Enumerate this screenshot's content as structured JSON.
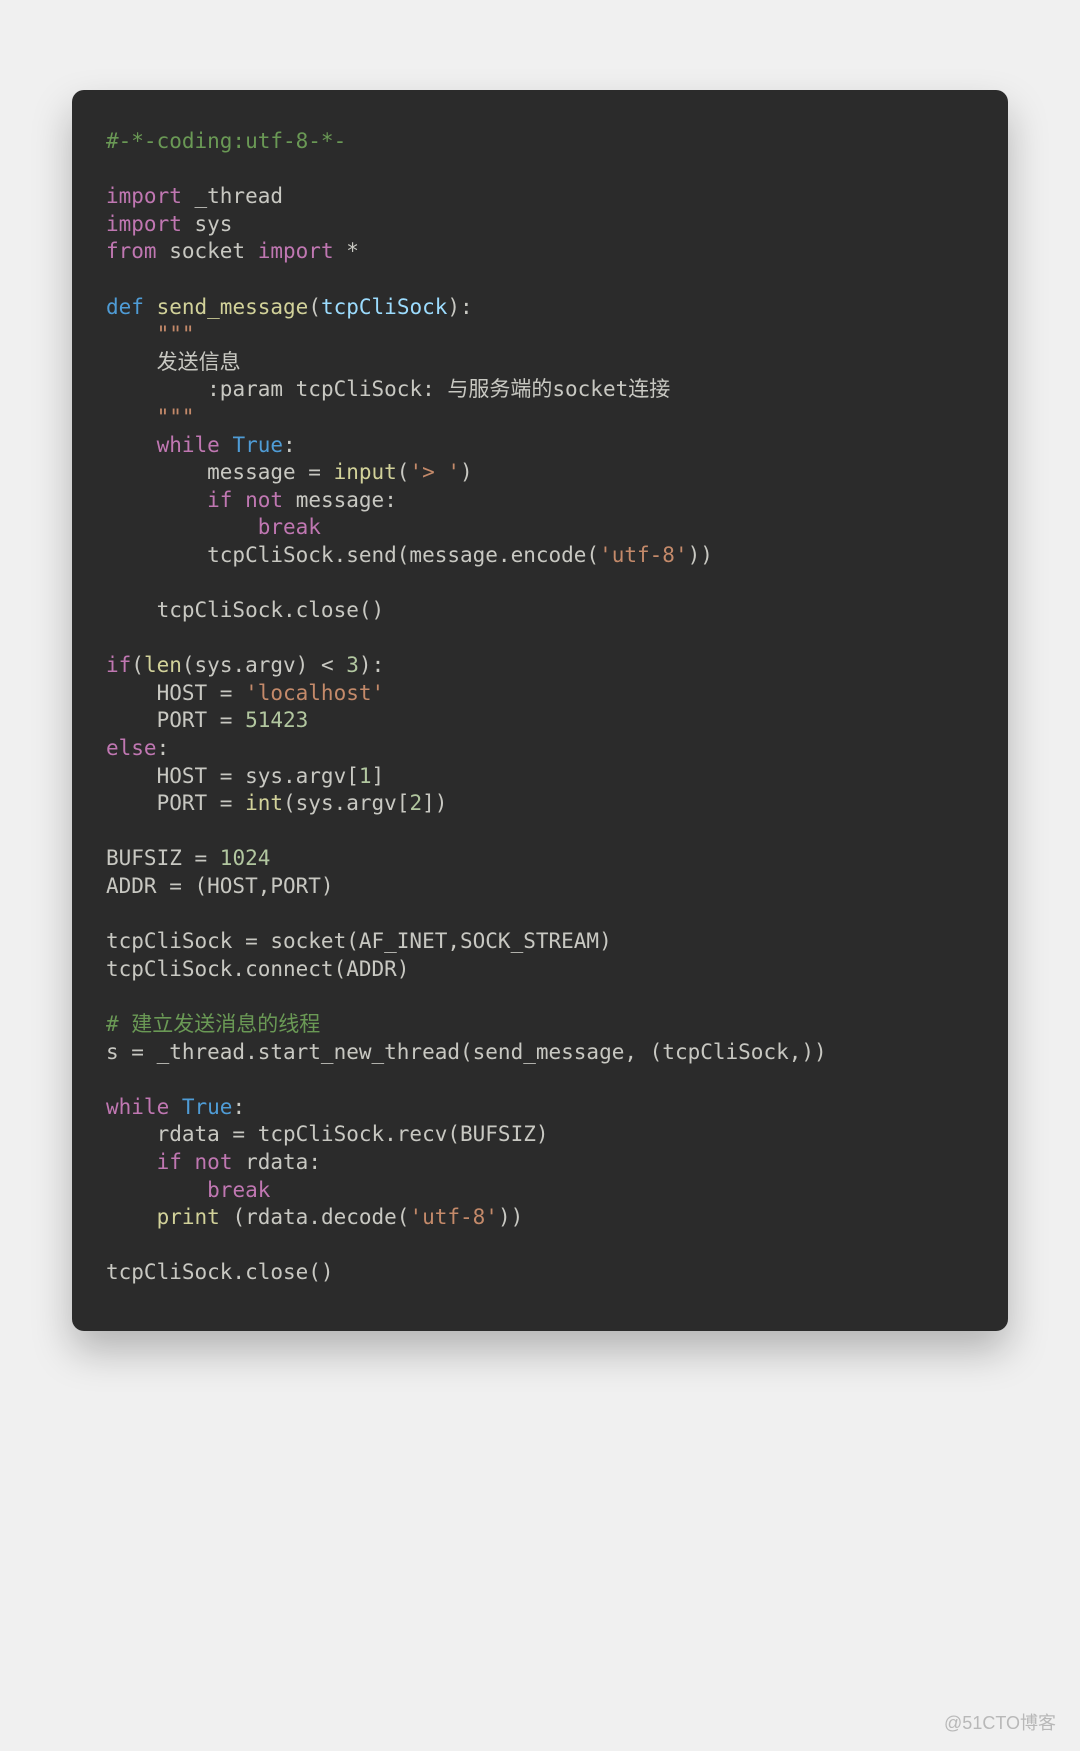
{
  "watermark": "@51CTO博客",
  "code": {
    "l1": {
      "a": "#-*-coding:utf-8-*-"
    },
    "l3": {
      "a": "import",
      "b": " _thread"
    },
    "l4": {
      "a": "import",
      "b": " sys"
    },
    "l5": {
      "a": "from",
      "b": " socket ",
      "c": "import",
      "d": " *"
    },
    "l7": {
      "a": "def",
      "b": " ",
      "c": "send_message",
      "d": "(",
      "e": "tcpCliSock",
      "f": "):"
    },
    "l8": {
      "a": "    ",
      "b": "\"\"\""
    },
    "l9": {
      "a": "    ",
      "b": "发送信息"
    },
    "l10": {
      "a": "        ",
      "b": ":param tcpCliSock: ",
      "c": "与服务端的socket连接"
    },
    "l11": {
      "a": "    ",
      "b": "\"\"\""
    },
    "l12": {
      "a": "    ",
      "b": "while",
      "c": " ",
      "d": "True",
      "e": ":"
    },
    "l13": {
      "a": "        message = ",
      "b": "input",
      "c": "(",
      "d": "'> '",
      "e": ")"
    },
    "l14": {
      "a": "        ",
      "b": "if",
      "c": " ",
      "d": "not",
      "e": " message:"
    },
    "l15": {
      "a": "            ",
      "b": "break"
    },
    "l16": {
      "a": "        tcpCliSock.send(message.encode(",
      "b": "'utf-8'",
      "c": "))"
    },
    "l18": {
      "a": "    tcpCliSock.close()"
    },
    "l20": {
      "a": "if",
      "b": "(",
      "c": "len",
      "d": "(sys.argv) < ",
      "e": "3",
      "f": "):"
    },
    "l21": {
      "a": "    HOST = ",
      "b": "'localhost'"
    },
    "l22": {
      "a": "    PORT = ",
      "b": "51423"
    },
    "l23": {
      "a": "else",
      "b": ":"
    },
    "l24": {
      "a": "    HOST = sys.argv[",
      "b": "1",
      "c": "]"
    },
    "l25": {
      "a": "    PORT = ",
      "b": "int",
      "c": "(sys.argv[",
      "d": "2",
      "e": "])"
    },
    "l27": {
      "a": "BUFSIZ = ",
      "b": "1024"
    },
    "l28": {
      "a": "ADDR = (HOST,PORT)"
    },
    "l30": {
      "a": "tcpCliSock = socket(AF_INET,SOCK_STREAM)"
    },
    "l31": {
      "a": "tcpCliSock.connect(ADDR)"
    },
    "l33": {
      "a": "# 建立发送消息的线程"
    },
    "l34": {
      "a": "s = _thread.start_new_thread(send_message, (tcpCliSock,))"
    },
    "l36": {
      "a": "while",
      "b": " ",
      "c": "True",
      "d": ":"
    },
    "l37": {
      "a": "    rdata = tcpCliSock.recv(BUFSIZ)"
    },
    "l38": {
      "a": "    ",
      "b": "if",
      "c": " ",
      "d": "not",
      "e": " rdata:"
    },
    "l39": {
      "a": "        ",
      "b": "break"
    },
    "l40": {
      "a": "    ",
      "b": "print",
      "c": " (rdata.decode(",
      "d": "'utf-8'",
      "e": "))"
    },
    "l42": {
      "a": "tcpCliSock.close()"
    }
  }
}
